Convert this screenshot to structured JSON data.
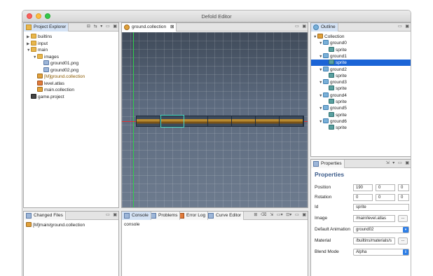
{
  "window": {
    "title": "Defold Editor"
  },
  "project_explorer": {
    "tab_label": "Project Explorer",
    "items": [
      {
        "label": "builtins",
        "kind": "folder",
        "depth": 0,
        "expanded": false
      },
      {
        "label": "input",
        "kind": "folder",
        "depth": 0,
        "expanded": false
      },
      {
        "label": "main",
        "kind": "folder",
        "depth": 0,
        "expanded": true
      },
      {
        "label": "images",
        "kind": "folder",
        "depth": 1,
        "expanded": true
      },
      {
        "label": "ground01.png",
        "kind": "image",
        "depth": 2
      },
      {
        "label": "ground02.png",
        "kind": "image",
        "depth": 2
      },
      {
        "label": "[M]ground.collection",
        "kind": "collection",
        "depth": 1
      },
      {
        "label": "level.atlas",
        "kind": "atlas",
        "depth": 1
      },
      {
        "label": "main.collection",
        "kind": "collection",
        "depth": 1
      },
      {
        "label": "game.project",
        "kind": "project",
        "depth": 0
      }
    ]
  },
  "changed_files": {
    "tab_label": "Changed Files",
    "items": [
      "[M]main/ground.collection"
    ]
  },
  "editor": {
    "tab_label": "ground.collection",
    "close_glyph": "⊠"
  },
  "bottom_tabs": {
    "tabs": [
      "Console",
      "Problems",
      "Error Log",
      "Curve Editor"
    ],
    "console_text": "console"
  },
  "outline": {
    "tab_label": "Outline",
    "root": "Collection",
    "items": [
      {
        "label": "ground0",
        "child": "sprite"
      },
      {
        "label": "ground1",
        "child": "sprite",
        "child_selected": true
      },
      {
        "label": "ground2",
        "child": "sprite"
      },
      {
        "label": "ground3",
        "child": "sprite"
      },
      {
        "label": "ground4",
        "child": "sprite"
      },
      {
        "label": "ground5",
        "child": "sprite"
      },
      {
        "label": "ground6",
        "child": "sprite"
      }
    ]
  },
  "properties": {
    "tab_label": "Properties",
    "heading": "Properties",
    "position_label": "Position",
    "position": [
      "190",
      "0",
      "0"
    ],
    "rotation_label": "Rotation",
    "rotation": [
      "0",
      "0",
      "0"
    ],
    "id_label": "Id",
    "id_value": "sprite",
    "image_label": "Image",
    "image_value": "/main/level.atlas",
    "default_animation_label": "Default Animation",
    "default_animation_value": "ground02",
    "material_label": "Material",
    "material_value": "/builtins/materials/s",
    "blend_mode_label": "Blend Mode",
    "blend_mode_value": "Alpha",
    "browse_label": "..."
  },
  "colors": {
    "selection": "#1b64d6",
    "scene_top": "#3f4a59",
    "scene_bottom": "#6d7b8e"
  }
}
